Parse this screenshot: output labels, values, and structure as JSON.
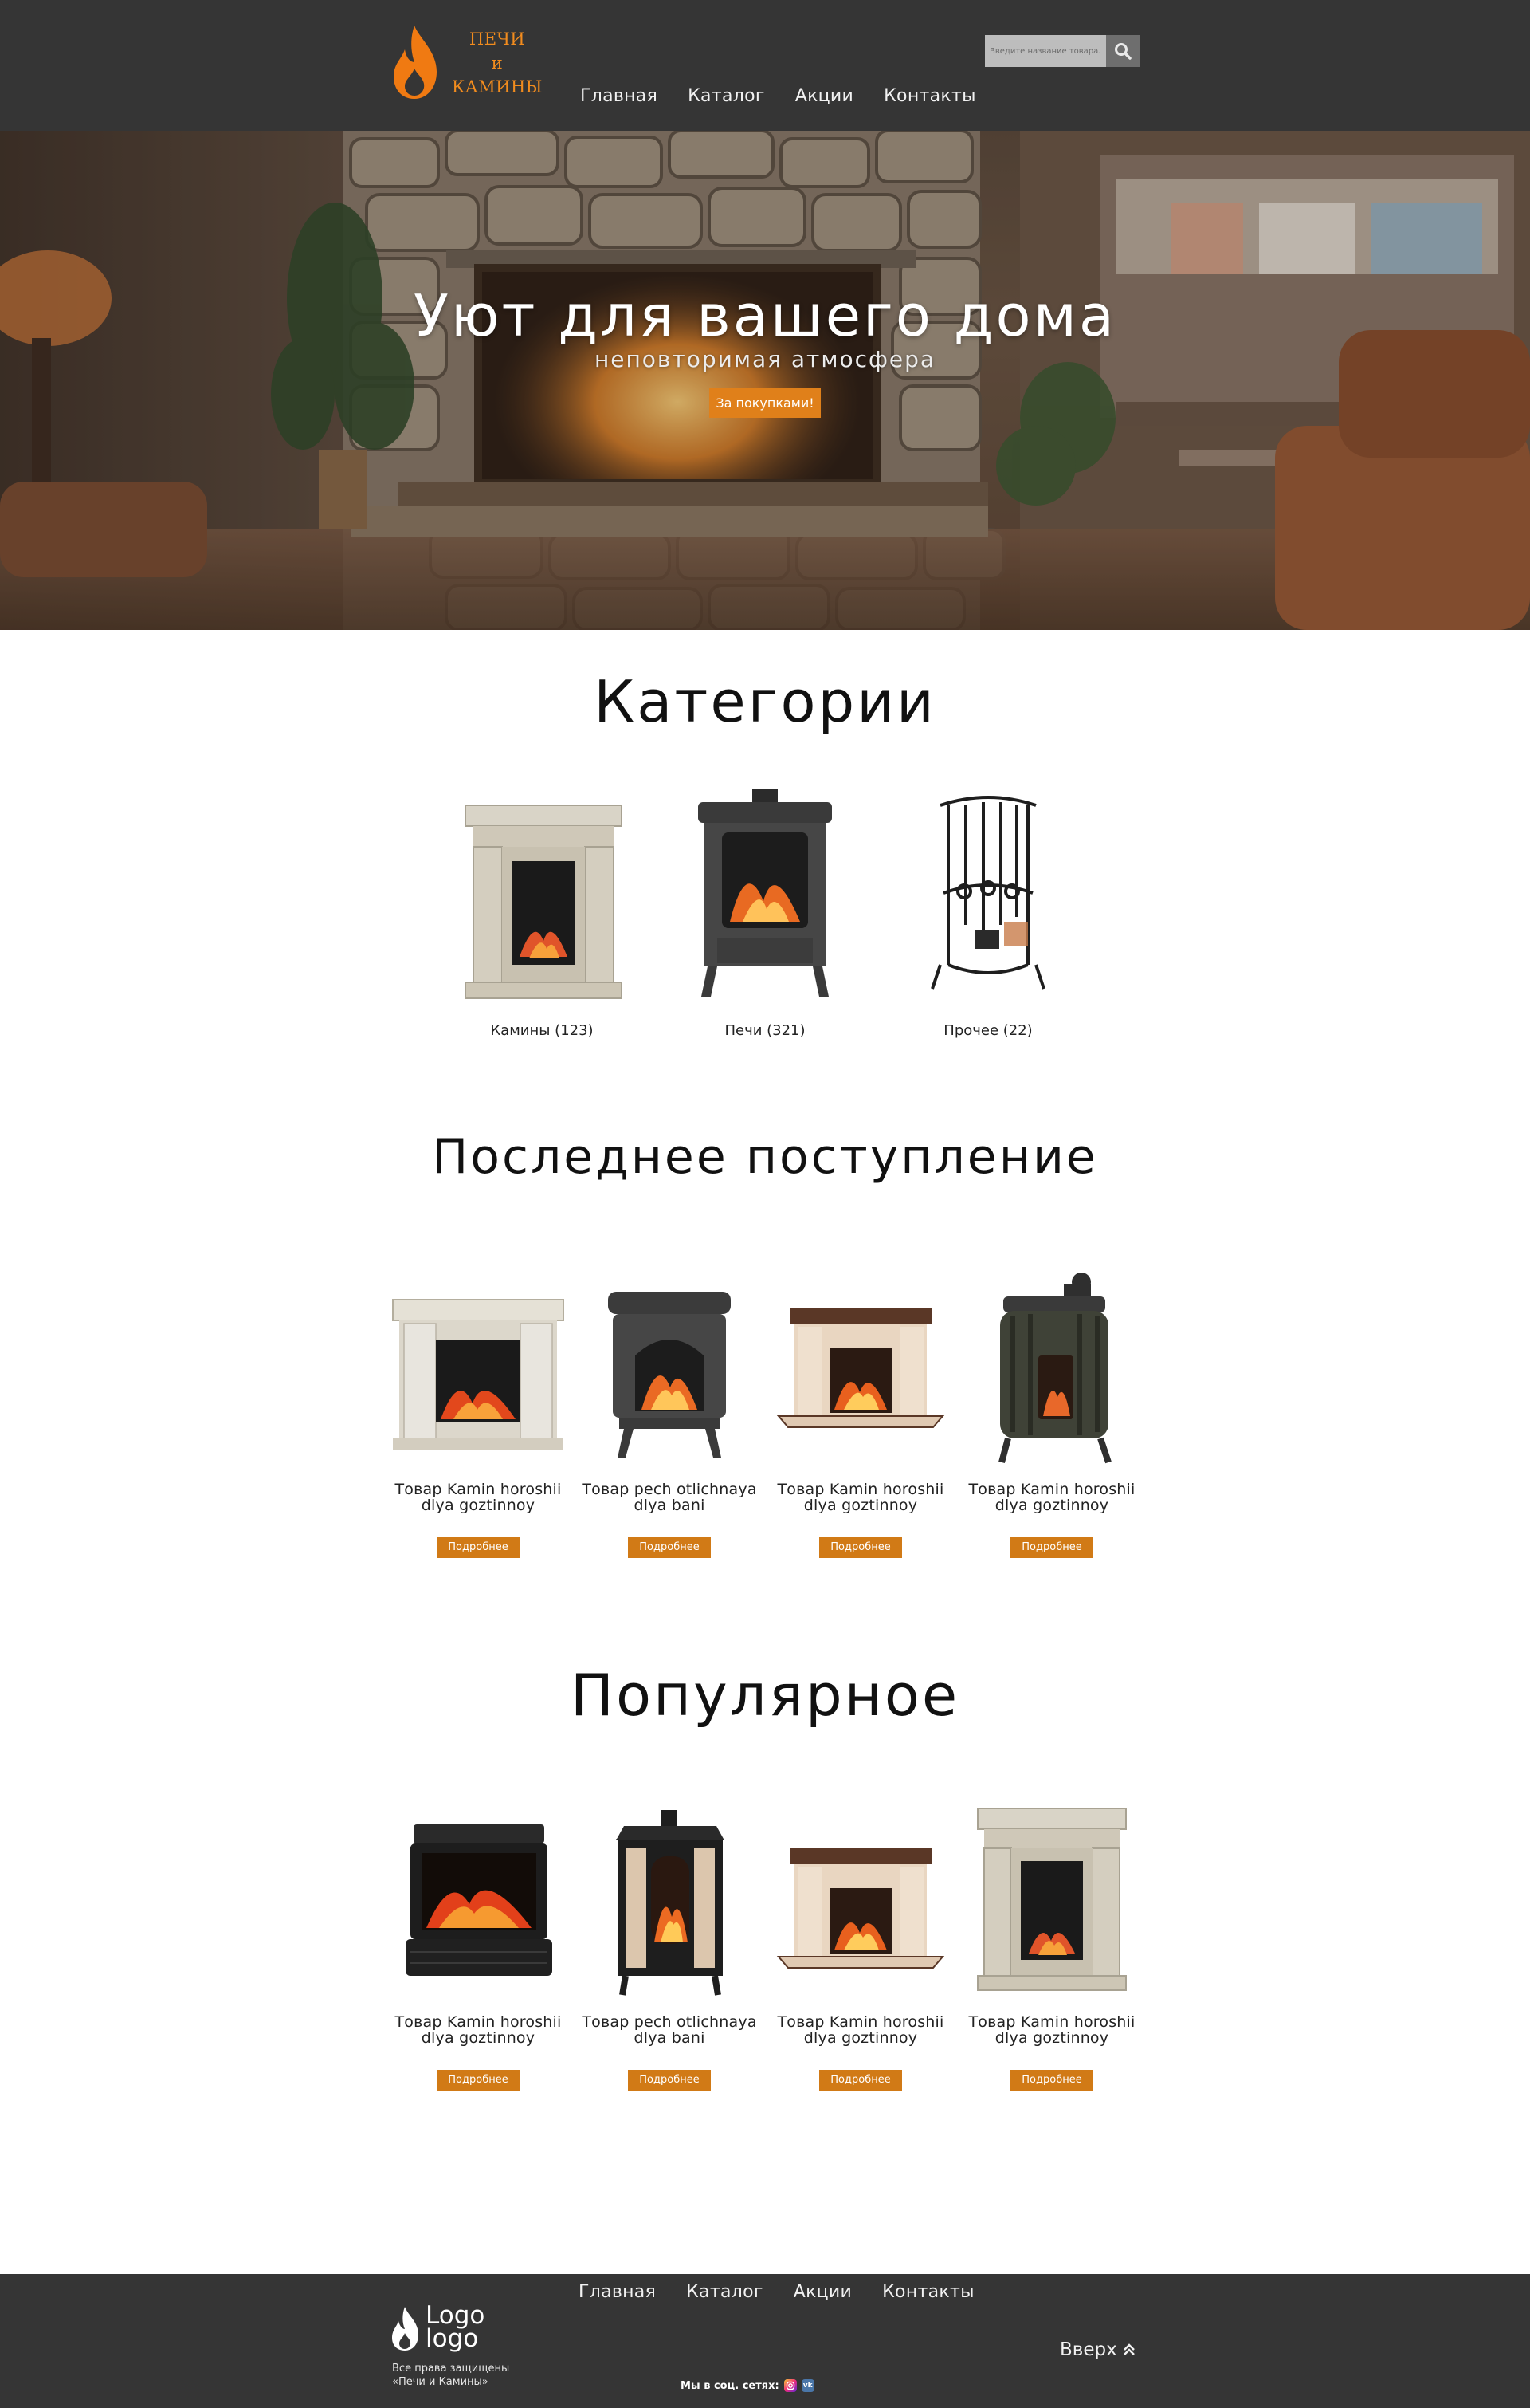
{
  "header": {
    "logo_line1": "ПЕЧИ",
    "logo_line2": "и",
    "logo_line3": "КАМИНЫ",
    "nav": [
      "Главная",
      "Каталог",
      "Акции",
      "Контакты"
    ],
    "search_placeholder": "Введите название товара..."
  },
  "hero": {
    "title": "Уют для вашего дома",
    "subtitle": "неповторимая атмосфера",
    "button": "За покупками!"
  },
  "categories": {
    "title": "Категории",
    "items": [
      {
        "label": "Камины (123)"
      },
      {
        "label": "Печи (321)"
      },
      {
        "label": "Прочее (22)"
      }
    ]
  },
  "latest": {
    "title": "Последнее поступление",
    "items": [
      {
        "name_line1": "Товар Kamin horoshii",
        "name_line2": "dlya goztinnoy",
        "button": "Подробнее"
      },
      {
        "name_line1": "Товар pech otlichnaya",
        "name_line2": "dlya bani",
        "button": "Подробнее"
      },
      {
        "name_line1": "Товар Kamin horoshii",
        "name_line2": "dlya goztinnoy",
        "button": "Подробнее"
      },
      {
        "name_line1": "Товар Kamin horoshii",
        "name_line2": "dlya goztinnoy",
        "button": "Подробнее"
      }
    ]
  },
  "popular": {
    "title": "Популярное",
    "items": [
      {
        "name_line1": "Товар Kamin horoshii",
        "name_line2": "dlya goztinnoy",
        "button": "Подробнее"
      },
      {
        "name_line1": "Товар pech otlichnaya",
        "name_line2": "dlya bani",
        "button": "Подробнее"
      },
      {
        "name_line1": "Товар Kamin horoshii",
        "name_line2": "dlya goztinnoy",
        "button": "Подробнее"
      },
      {
        "name_line1": "Товар Kamin horoshii",
        "name_line2": "dlya goztinnoy",
        "button": "Подробнее"
      }
    ]
  },
  "footer": {
    "nav": [
      "Главная",
      "Каталог",
      "Акции",
      "Контакты"
    ],
    "logo_line1": "Logo",
    "logo_line2": "logo",
    "copyright_line1": "Все права защищены",
    "copyright_line2": "«Печи и Камины»",
    "socials_label": "Мы в соц. сетях:",
    "socials_icons": [
      "instagram-icon",
      "vk-icon"
    ],
    "top_link": "Вверх"
  },
  "colors": {
    "header_bg": "#353535",
    "accent": "#e0801a",
    "logo_orange": "#f28c1e"
  }
}
